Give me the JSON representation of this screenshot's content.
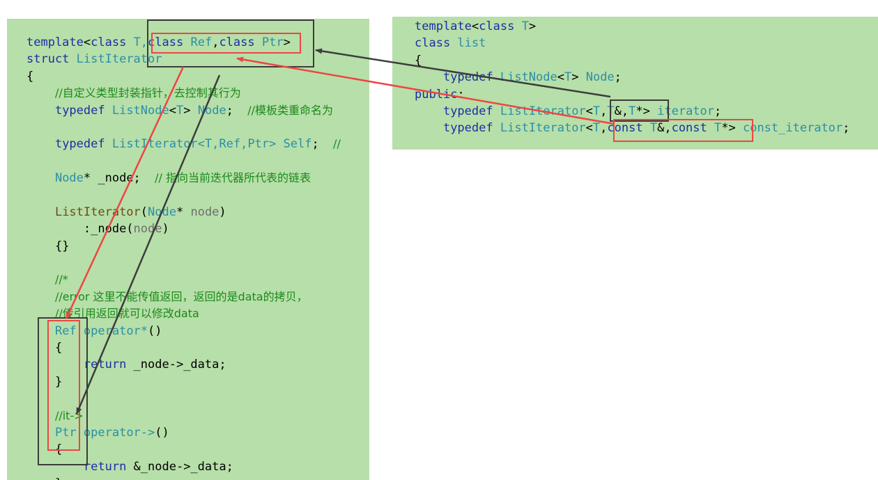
{
  "left_code": {
    "l1": {
      "a": "template",
      "b": "<",
      "c": "class",
      "d": " T,",
      "e": "class",
      "f": " Ref",
      "g": ",",
      "h": "class",
      "i": " Ptr",
      "j": ">"
    },
    "l2": {
      "a": "struct",
      "b": " ListIterator"
    },
    "l3": "{",
    "l4": "//自定义类型封装指针，去控制其行为",
    "l5": {
      "a": "typedef",
      "b": " ListNode",
      "c": "<",
      "d": "T",
      "e": ">",
      "f": " Node",
      "g": ";",
      "h": "    //模板类重命名为"
    },
    "l7": {
      "a": "typedef",
      "b": " ListIterator",
      "c": "<T,Ref,Ptr>",
      "d": " Self",
      "e": ";",
      "f": "    //"
    },
    "l9": {
      "a": "Node",
      "b": "* _node;",
      "c": "    // 指向当前迭代器所代表的链表"
    },
    "l11": {
      "a": "ListIterator",
      "b": "(",
      "c": "Node",
      "d": "* ",
      "e": "node",
      "f": ")"
    },
    "l12": {
      "a": ":_node(",
      "b": "node",
      "c": ")"
    },
    "l13": "{}",
    "l15": "//*",
    "l16": "//error 这里不能传值返回，返回的是data的拷贝，",
    "l17": "//传引用返回就可以修改data",
    "l18": {
      "a": "Ref",
      "b": " operator",
      "c": "*",
      "d": "()"
    },
    "l19": "{",
    "l20": {
      "a": "return",
      "b": " _node->_data;"
    },
    "l21": "}",
    "l23": "//it->",
    "l24": {
      "a": "Ptr",
      "b": " operator->",
      "c": "()"
    },
    "l25": "{",
    "l26": {
      "a": "return",
      "b": " &_node->_data;"
    },
    "l27": "}"
  },
  "right_code": {
    "r1": {
      "a": "template",
      "b": "<",
      "c": "class",
      "d": " T",
      "e": ">"
    },
    "r2": {
      "a": "class",
      "b": " list"
    },
    "r3": "{",
    "r4": {
      "a": "typedef",
      "b": " ListNode",
      "c": "<",
      "d": "T",
      "e": ">",
      "f": " Node",
      "g": ";"
    },
    "r5": {
      "a": "public",
      "b": ":"
    },
    "r6": {
      "a": "typedef",
      "b": " ListIterator",
      "c": "<",
      "d": "T",
      "e": ",",
      "f": "T",
      "g": "&,",
      "h": "T",
      "i": "*> ",
      "j": "iterator",
      "k": ";"
    },
    "r7": {
      "a": "typedef",
      "b": " ListIterator",
      "c": "<",
      "d": "T",
      "e": ",",
      "f": "const",
      "g": " T",
      "h": "&,",
      "i": "const",
      "j": " T",
      "k": "*> ",
      "l": "const_iterator",
      "m": ";"
    }
  },
  "colors": {
    "background": "#b7dfa9",
    "keyword": "#1c2ea3",
    "type": "#2b8fa6",
    "comment": "#1b8a1b",
    "highlight_red": "#ee4444",
    "highlight_dark": "#3c3c3c"
  }
}
